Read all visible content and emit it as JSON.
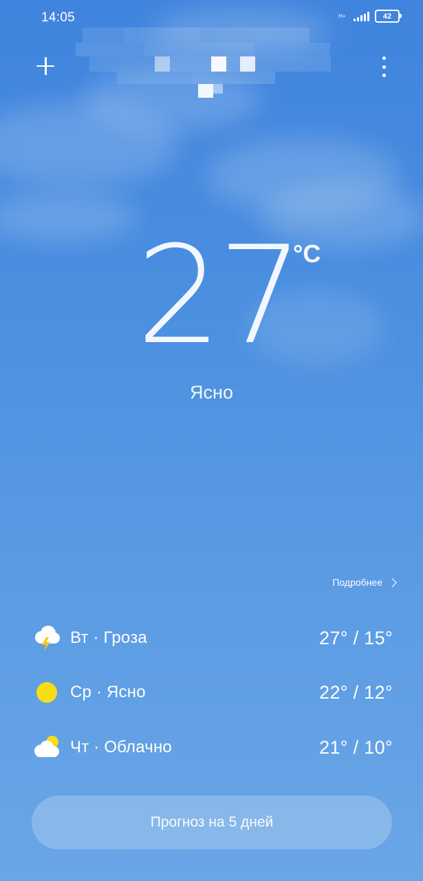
{
  "status_bar": {
    "time": "14:05",
    "network_type": "H+",
    "battery_level": "42"
  },
  "header": {
    "add_icon": "plus-icon",
    "more_icon": "more-vertical-icon"
  },
  "current": {
    "temperature": "27",
    "unit": "°C",
    "condition": "Ясно"
  },
  "details_link": {
    "label": "Подробнее",
    "icon": "chevron-right-icon"
  },
  "forecast": [
    {
      "label": "Вт · Гроза",
      "temps": "27° / 15°",
      "icon": "thunderstorm-icon"
    },
    {
      "label": "Ср · Ясно",
      "temps": "22° / 12°",
      "icon": "sun-icon"
    },
    {
      "label": "Чт · Облачно",
      "temps": "21° / 10°",
      "icon": "partly-cloudy-icon"
    }
  ],
  "forecast_button": {
    "label": "Прогноз на 5 дней"
  },
  "colors": {
    "sky_top": "#3f84de",
    "sky_bottom": "#6aa6e6",
    "sun": "#f7dc16",
    "lightning": "#f5c518"
  }
}
